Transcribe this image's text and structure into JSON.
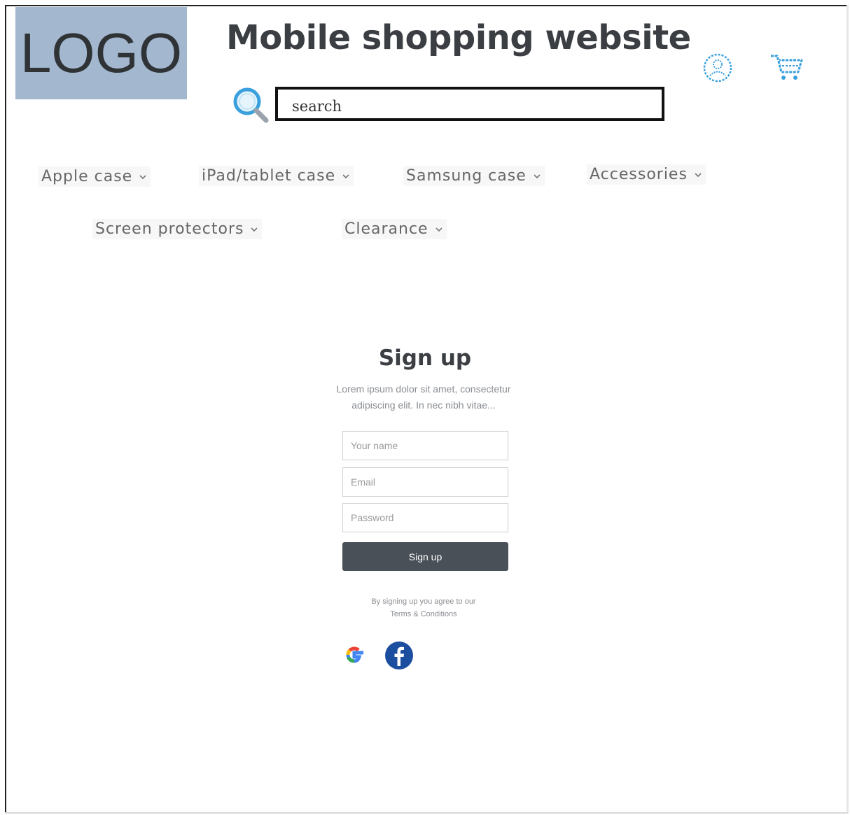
{
  "header": {
    "logo_text": "LOGO",
    "site_title": "Mobile shopping website",
    "search_placeholder": "search",
    "icons": {
      "search": "search-icon",
      "account": "user-account-icon",
      "cart": "shopping-cart-icon"
    }
  },
  "nav": {
    "items": [
      {
        "label": "Apple case"
      },
      {
        "label": "iPad/tablet case"
      },
      {
        "label": "Samsung case"
      },
      {
        "label": "Accessories"
      },
      {
        "label": "Screen protectors"
      },
      {
        "label": "Clearance"
      }
    ]
  },
  "signup": {
    "title": "Sign up",
    "subtitle_line1": "Lorem ipsum dolor sit amet, consectetur",
    "subtitle_line2": "adipiscing elit. In nec nibh vitae...",
    "name_placeholder": "Your name",
    "email_placeholder": "Email",
    "password_placeholder": "Password",
    "button_label": "Sign up",
    "agree_text": "By signing up you agree to our",
    "terms_label": "Terms & Conditions",
    "social": [
      "google-icon",
      "facebook-icon"
    ]
  },
  "colors": {
    "logo_bg": "#a3b7cf",
    "accent_blue": "#3aa0dd",
    "button_bg": "#4a5058",
    "facebook_blue": "#1c4ea0"
  }
}
